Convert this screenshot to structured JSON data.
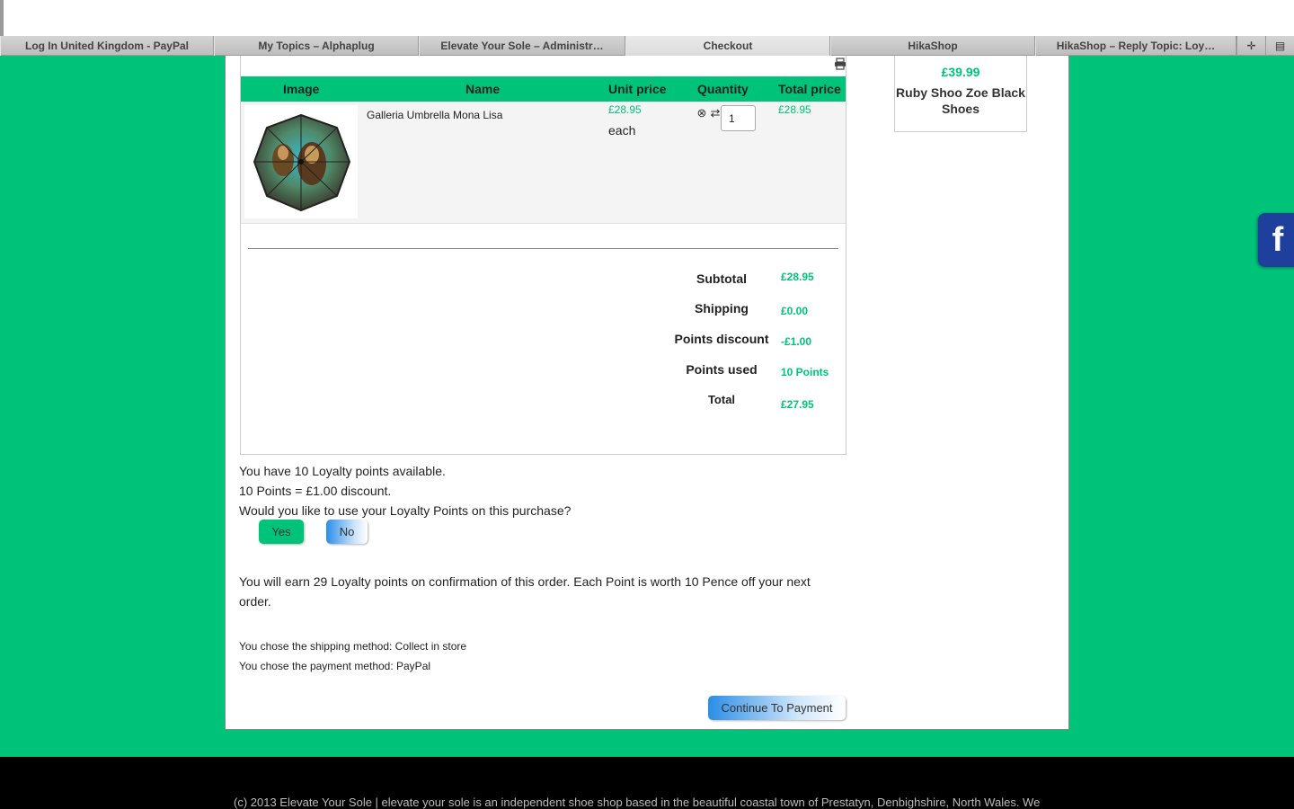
{
  "browser": {
    "tabs": [
      {
        "label": "Log In United Kingdom - PayPal"
      },
      {
        "label": "My Topics – Alphaplug"
      },
      {
        "label": "Elevate Your Sole – Administr…"
      },
      {
        "label": "Checkout"
      },
      {
        "label": "HikaShop"
      },
      {
        "label": "HikaShop – Reply Topic: Loy…"
      }
    ],
    "new_tab_icon": "plus-icon",
    "tab_list_icon": "list-icon"
  },
  "cart": {
    "headers": {
      "image": "Image",
      "name": "Name",
      "unit_price": "Unit price",
      "quantity": "Quantity",
      "total_price": "Total price"
    },
    "items": [
      {
        "name": "Galleria Umbrella Mona Lisa",
        "unit_price": "£28.95",
        "unit": "each",
        "quantity": "1",
        "total_price": "£28.95"
      }
    ],
    "totals": {
      "subtotal_label": "Subtotal",
      "subtotal_value": "£28.95",
      "shipping_label": "Shipping",
      "shipping_value": "£0.00",
      "points_discount_label": "Points discount",
      "points_discount_value": "-£1.00",
      "points_used_label": "Points used",
      "points_used_value": "10 Points",
      "total_label": "Total",
      "total_value": "£27.95"
    }
  },
  "loyalty": {
    "available": "You have 10 Loyalty points available.",
    "rate": "10 Points = £1.00 discount.",
    "question": "Would you like to use your Loyalty Points on this purchase?",
    "yes_label": "Yes",
    "no_label": "No",
    "earn": "You will earn 29 Loyalty points on confirmation of this order. Each Point is worth 10 Pence off your next order."
  },
  "methods": {
    "shipping": "You chose the shipping method: Collect in store",
    "payment": "You chose the payment method: PayPal"
  },
  "continue_label": "Continue To Payment",
  "side_product": {
    "price": "£39.99",
    "name": "Ruby Shoo Zoe Black Shoes"
  },
  "social": {
    "facebook_glyph": "f"
  },
  "footer": {
    "text": "(c) 2013 Elevate Your Sole | elevate your sole is an independent shoe shop based in the beautiful coastal town of Prestatyn, Denbighshire, North Wales. We"
  },
  "colors": {
    "brand_green": "#00c37a",
    "footer_black": "#000000",
    "facebook_blue": "#1f3f9c"
  }
}
